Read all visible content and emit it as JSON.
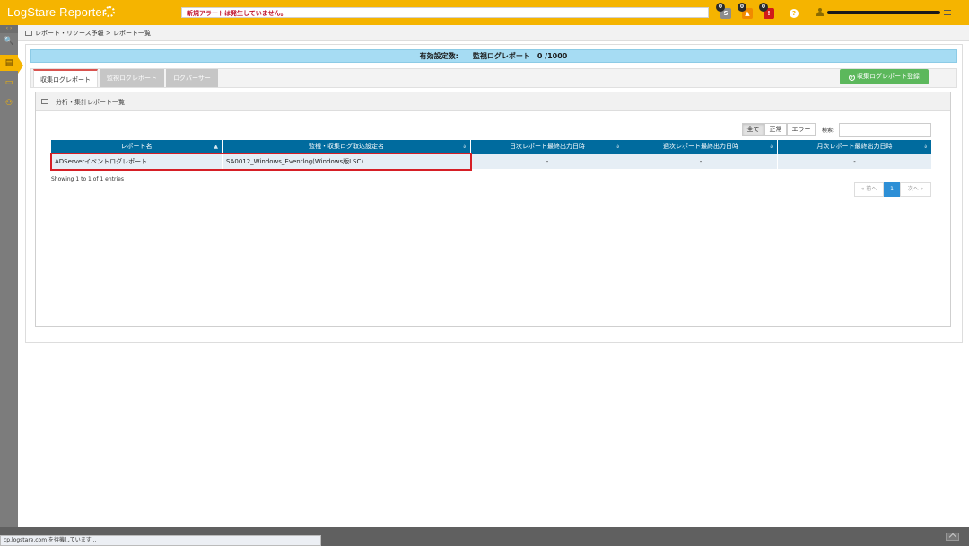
{
  "header": {
    "brand": "LogStare Reporter",
    "alert_text": "新規アラートは発生していません。",
    "badges": [
      {
        "count": "0",
        "glyph": "S",
        "color": "#8c8c8c"
      },
      {
        "count": "0",
        "glyph": "▲",
        "color": "#f08a00"
      },
      {
        "count": "0",
        "glyph": "!",
        "color": "#d11a1a"
      }
    ],
    "help_glyph": "?"
  },
  "sidebar": {
    "toggle": "‹ ›",
    "items": [
      {
        "icon": "search-icon",
        "glyph": "🔍"
      },
      {
        "icon": "report-icon",
        "glyph": "▤"
      },
      {
        "icon": "chat-icon",
        "glyph": "▭"
      },
      {
        "icon": "users-icon",
        "glyph": "⚇"
      }
    ]
  },
  "breadcrumb": "レポート・リソース予報 > レポート一覧",
  "summary": {
    "label": "有効設定数:",
    "value": "監視ログレポート　0 /1000"
  },
  "tabs": [
    {
      "label": "収集ログレポート",
      "active": true
    },
    {
      "label": "監視ログレポート",
      "active": false
    },
    {
      "label": "ログパーサー",
      "active": false
    }
  ],
  "register_button": "収集ログレポート登録",
  "section_title": "分析・集計レポート一覧",
  "filters": [
    "全て",
    "正常",
    "エラー"
  ],
  "search": {
    "label": "検索:",
    "value": ""
  },
  "table": {
    "columns": [
      "レポート名",
      "監視・収集ログ取込設定名",
      "日次レポート最終出力日時",
      "週次レポート最終出力日時",
      "月次レポート最終出力日時"
    ],
    "rows": [
      [
        "ADServerイベントログレポート",
        "SA0012_Windows_Eventlog(Windows版LSC)",
        "-",
        "-",
        "-"
      ]
    ]
  },
  "entries_info": "Showing 1 to 1 of 1 entries",
  "pagination": {
    "prev": "« 前へ",
    "current": "1",
    "next": "次へ »"
  },
  "status_bar": "cp.logstare.com を待機しています..."
}
